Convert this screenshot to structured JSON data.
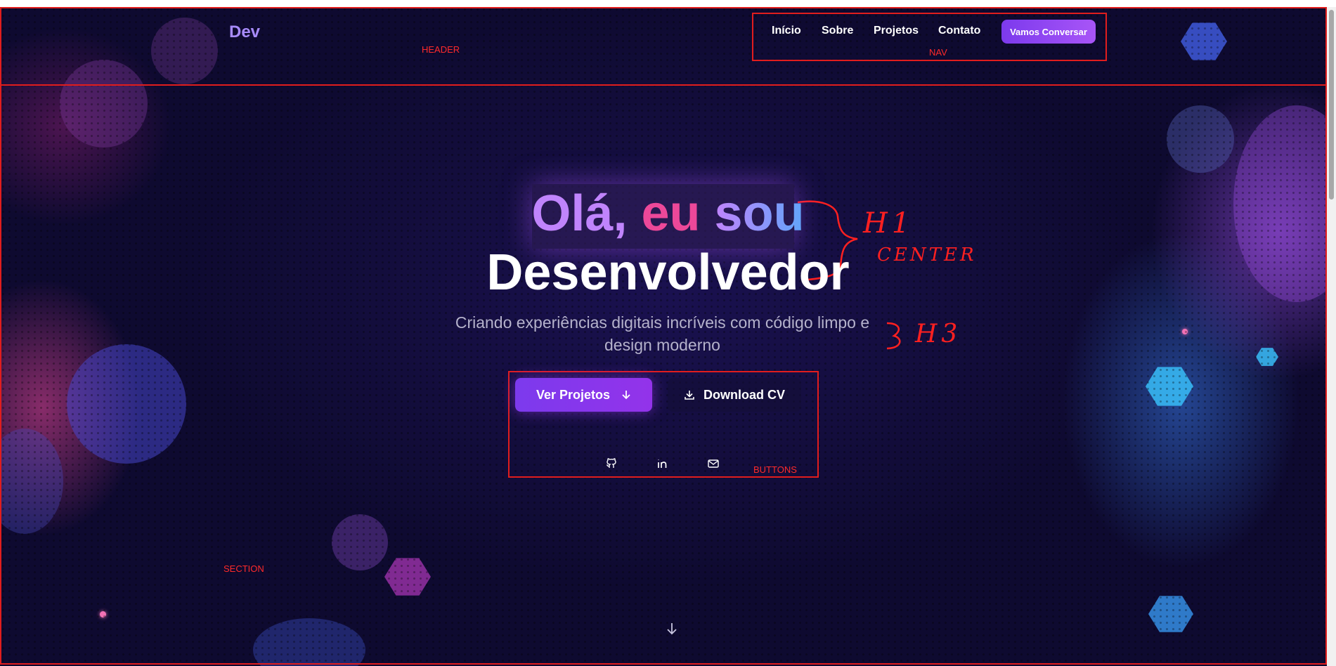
{
  "header": {
    "logo": "Dev",
    "annotation": "HEADER"
  },
  "nav": {
    "items": [
      {
        "label": "Início"
      },
      {
        "label": "Sobre"
      },
      {
        "label": "Projetos"
      },
      {
        "label": "Contato"
      }
    ],
    "cta_label": "Vamos Conversar",
    "annotation": "NAV"
  },
  "hero": {
    "title_line1": {
      "w1": "Olá,",
      "w2": "eu",
      "w3": "sou"
    },
    "title_line2": "Desenvolvedor",
    "subtitle": "Criando experiências digitais incríveis com código limpo e design moderno",
    "primary_button": "Ver Projetos",
    "secondary_button": "Download CV",
    "social_icons": [
      "github-icon",
      "linkedin-icon",
      "mail-icon"
    ],
    "buttons_annotation": "BUTTONS",
    "section_annotation": "SECTION"
  },
  "handwritten": {
    "h1": "H1",
    "center": "CENTER",
    "h3": "H3"
  },
  "colors": {
    "accent": "#7c3aed",
    "logo": "#a78bfa",
    "pink": "#ec4899",
    "annotation": "#e11d1d"
  }
}
